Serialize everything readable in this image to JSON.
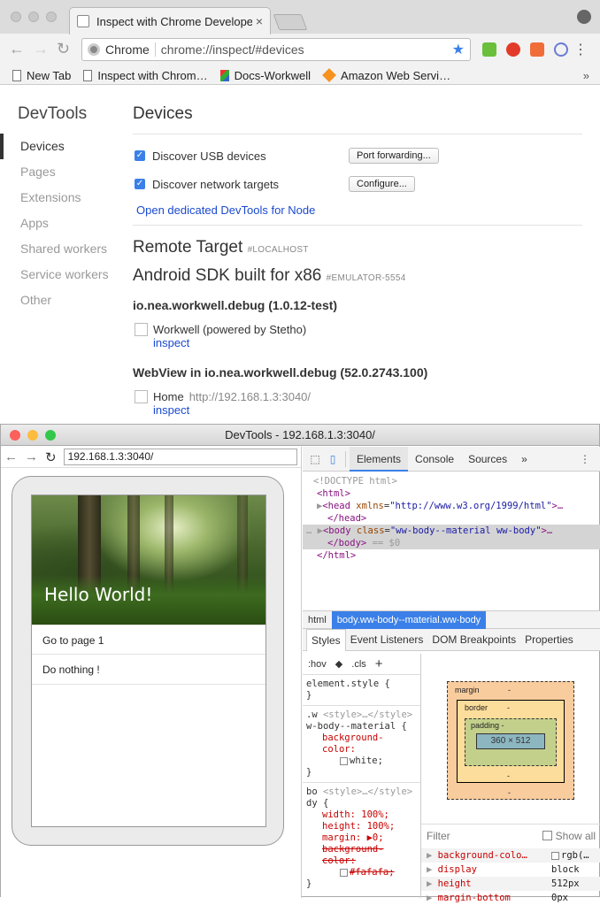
{
  "window": {
    "tab_title": "Inspect with Chrome Develope",
    "tab_close": "×"
  },
  "toolbar": {
    "back": "←",
    "forward": "→",
    "reload": "↻",
    "chip": "Chrome",
    "url": "chrome://inspect/#devices",
    "star": "★",
    "menu": "⋮"
  },
  "bookmarks": {
    "items": [
      "New Tab",
      "Inspect with Chrom…",
      "Docs-Workwell",
      "Amazon Web Servi…"
    ],
    "more": "»"
  },
  "sidebar": {
    "title": "DevTools",
    "items": [
      "Devices",
      "Pages",
      "Extensions",
      "Apps",
      "Shared workers",
      "Service workers",
      "Other"
    ]
  },
  "devices": {
    "heading": "Devices",
    "usb_label": "Discover USB devices",
    "usb_button": "Port forwarding...",
    "network_label": "Discover network targets",
    "network_button": "Configure...",
    "node_link": "Open dedicated DevTools for Node",
    "remote_heading": "Remote Target",
    "remote_tag": "#LOCALHOST",
    "device_heading": "Android SDK built for x86",
    "device_tag": "#EMULATOR-5554",
    "app1": "io.nea.workwell.debug (1.0.12-test)",
    "target1_title": "Workwell (powered by Stetho)",
    "inspect": "inspect",
    "app2": "WebView in io.nea.workwell.debug (52.0.2743.100)",
    "target2_title": "Home",
    "target2_url": "http://192.168.1.3:3040/"
  },
  "devtools": {
    "title": "DevTools - 192.168.1.3:3040/",
    "url": "192.168.1.3:3040/",
    "tabs": [
      "Elements",
      "Console",
      "Sources",
      "»"
    ],
    "dom": {
      "doctype": "<!DOCTYPE html>",
      "html_open": "<html>",
      "head_tag": "<head",
      "head_attr": "xmlns",
      "head_val": "\"http://www.w3.org/1999/html\"",
      "head_rest": ">…",
      "head_close": "</head>",
      "body_tag": "<body",
      "body_attr": "class",
      "body_val": "\"ww-body--material ww-body\"",
      "body_rest": ">…",
      "body_close": "</body>",
      "body_eq": "== $0",
      "html_close": "</html>"
    },
    "crumbs": [
      "html",
      "body.ww-body--material.ww-body"
    ],
    "subtabs": [
      "Styles",
      "Event Listeners",
      "DOM Breakpoints",
      "Properties"
    ],
    "styles": {
      "hov": ":hov",
      "cls": ".cls",
      "plus": "+",
      "element_style": "element.style {",
      "close": "}",
      "rule1_selector": ".w",
      "rule1_source": "<style>…</style>",
      "rule1_selector2": "w-body--material {",
      "rule1_prop": "background-color:",
      "rule1_val": "white;",
      "rule2_selector": "bo",
      "rule2_source": "<style>…</style>",
      "rule2_selector2": "dy {",
      "width": "width: 100%;",
      "height": "height: 100%;",
      "margin": "margin: ▶0;",
      "bg": "background-color:",
      "bg_val": "#fafafa;"
    },
    "boxmodel": {
      "margin": "margin",
      "border": "border",
      "padding": "padding -",
      "content": "360 × 512",
      "dash": "-"
    },
    "filter": {
      "placeholder": "Filter",
      "show_all": "Show all"
    },
    "computed": [
      {
        "name": "background-colo…",
        "value": "rgb(…"
      },
      {
        "name": "display",
        "value": "block"
      },
      {
        "name": "height",
        "value": "512px"
      },
      {
        "name": "margin-bottom",
        "value": "0px"
      }
    ]
  },
  "phone": {
    "hero_text": "Hello World!",
    "items": [
      "Go to page 1",
      "Do nothing !"
    ]
  },
  "colors": {
    "accent": "#3b80e8",
    "link": "#1a4ad0"
  }
}
